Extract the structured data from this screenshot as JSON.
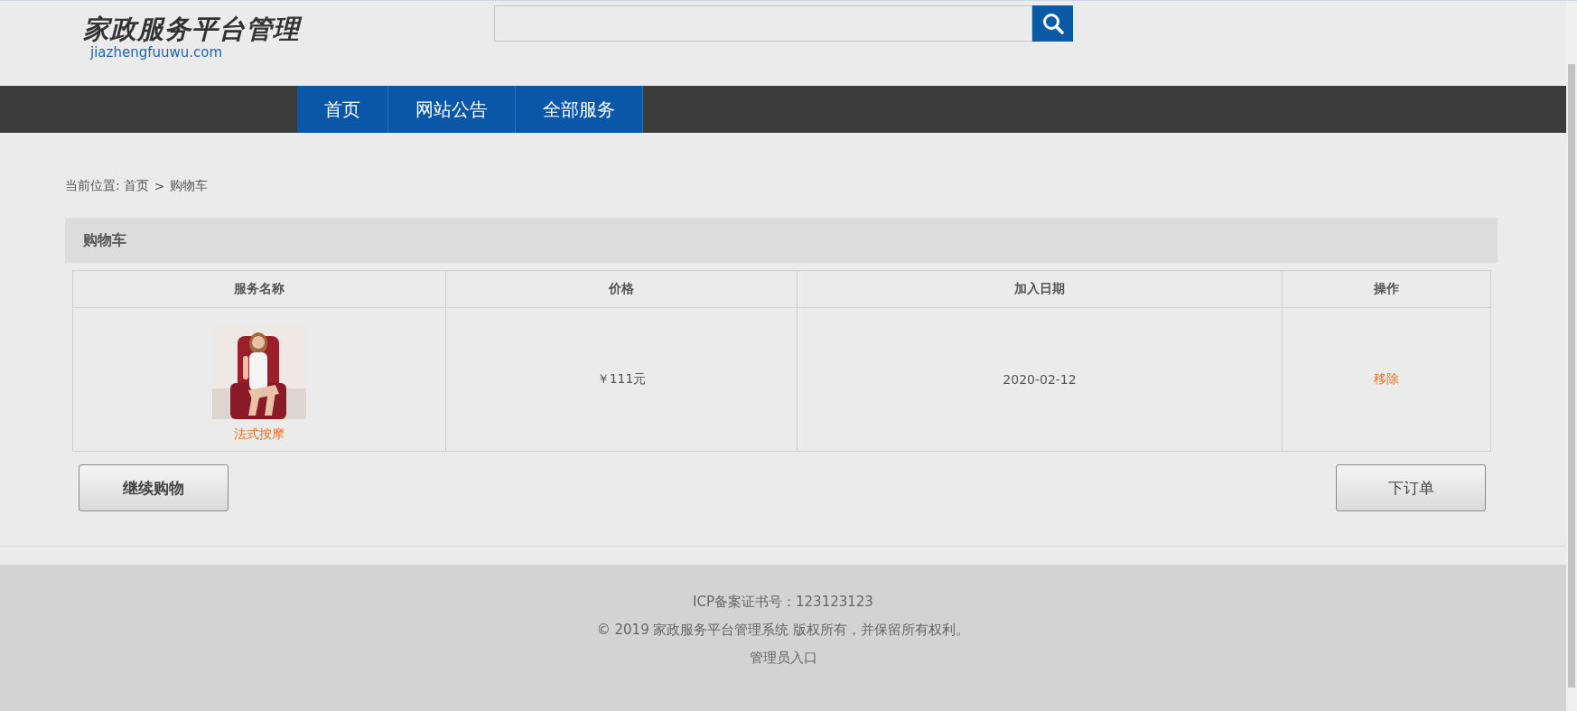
{
  "logo": {
    "title": "家政服务平台管理",
    "domain": "jiazhengfuuwu.com"
  },
  "search": {
    "kind": "field"
  },
  "nav": [
    {
      "label": "首页"
    },
    {
      "label": "网站公告"
    },
    {
      "label": "全部服务"
    }
  ],
  "breadcrumb": {
    "prefix": "当前位置:",
    "items": [
      "首页",
      "购物车"
    ],
    "separator": ">"
  },
  "cart": {
    "title": "购物车",
    "columns": [
      "服务名称",
      "价格",
      "加入日期",
      "操作"
    ],
    "rows": [
      {
        "name": "法式按摩",
        "price": "￥111元",
        "date": "2020-02-12",
        "action": "移除"
      }
    ]
  },
  "buttons": [
    {
      "label": "继续购物",
      "kind": "continue"
    },
    {
      "label": "下订单",
      "kind": "order"
    }
  ],
  "footer": {
    "icp": "ICP备案证书号：123123123",
    "copyright": "© 2019 家政服务平台管理系统 版权所有，并保留所有权利。",
    "admin_link": "管理员入口"
  }
}
